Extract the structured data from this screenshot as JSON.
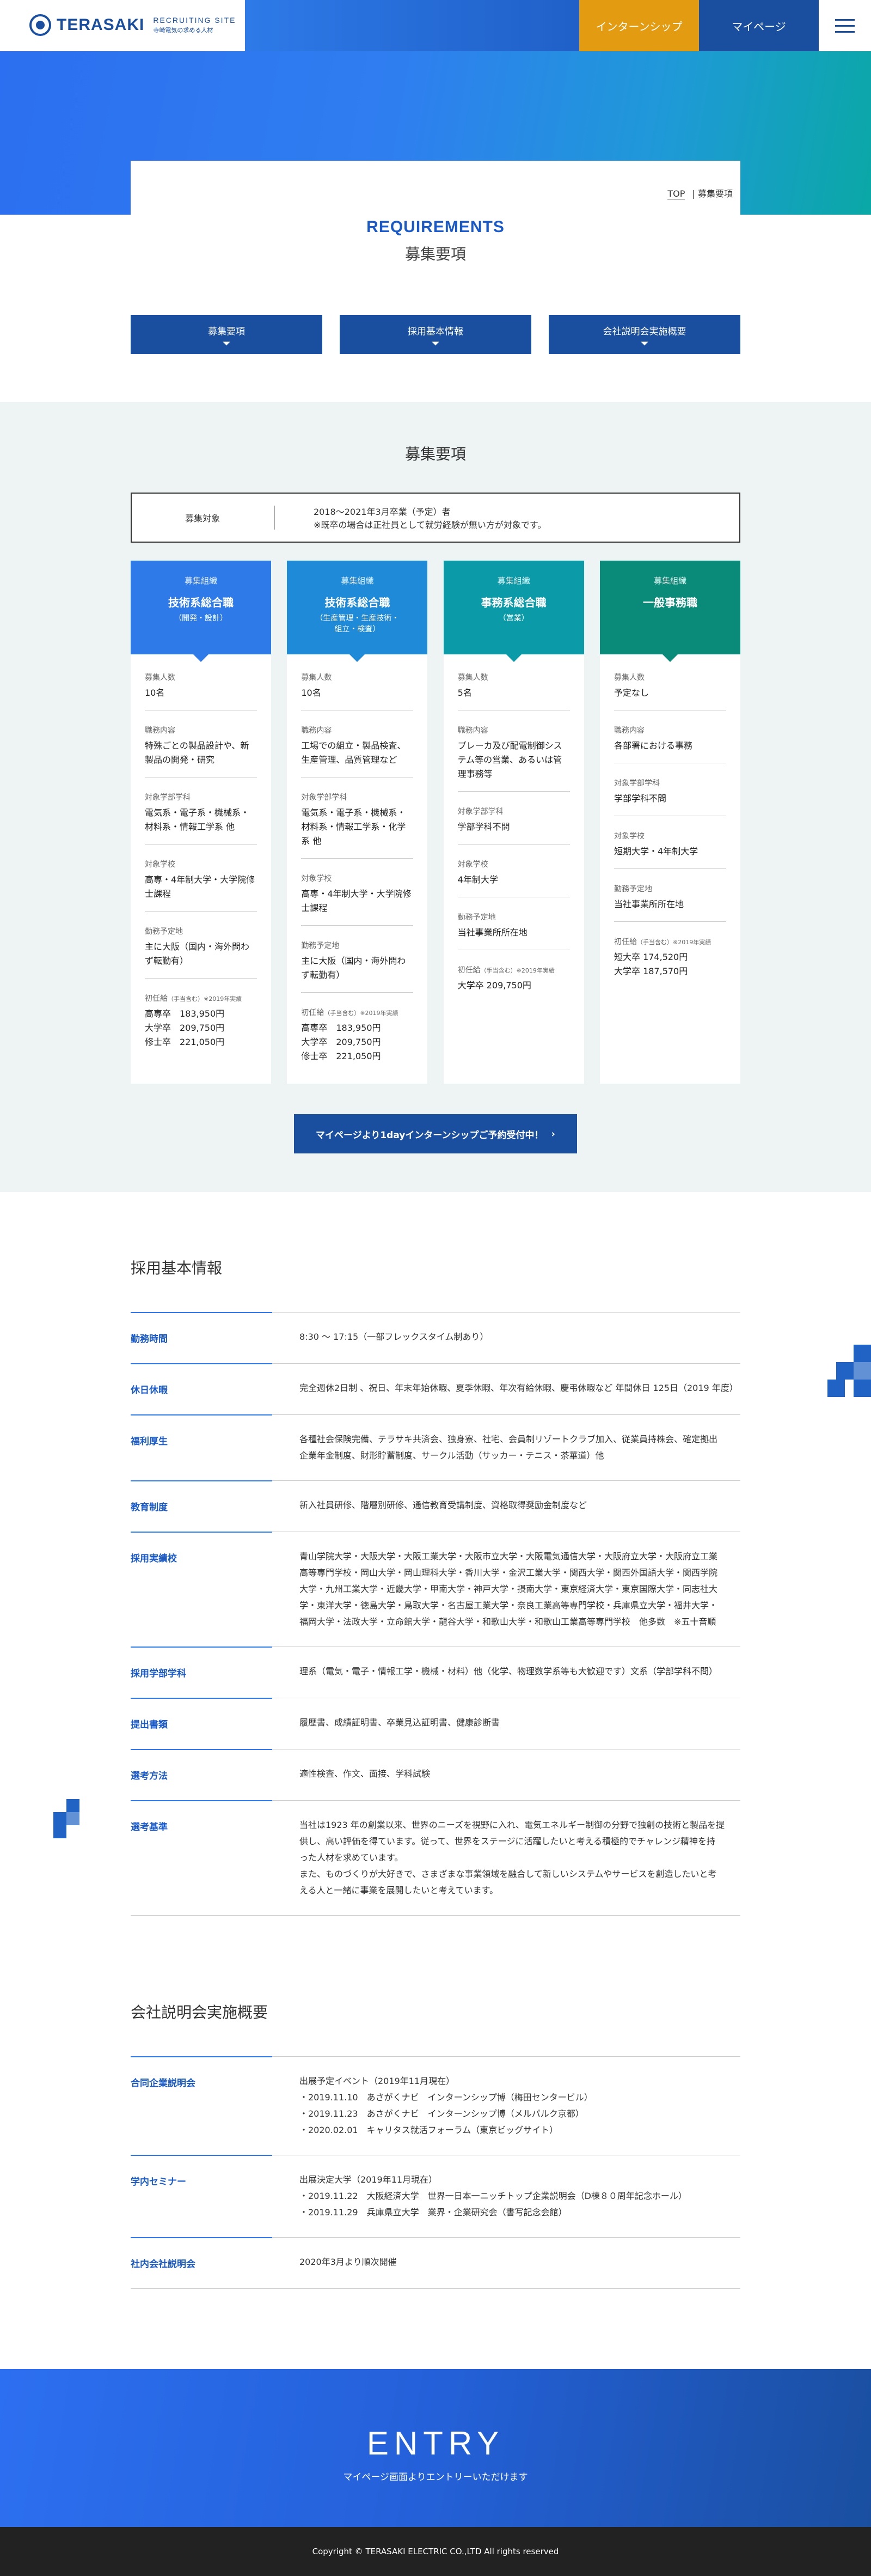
{
  "header": {
    "logo_text": "TERASAKI",
    "logo_sub1": "RECRUITING SITE",
    "logo_sub2": "寺崎電気の求める人材",
    "intern_label": "インターンシップ",
    "mypage_label": "マイページ"
  },
  "breadcrumb": {
    "top": "TOP",
    "sep": "|",
    "current": "募集要項"
  },
  "page": {
    "title_en": "REQUIREMENTS",
    "title_jp": "募集要項"
  },
  "tabs": [
    {
      "label": "募集要項"
    },
    {
      "label": "採用基本情報"
    },
    {
      "label": "会社説明会実施概要"
    }
  ],
  "recruit": {
    "title": "募集要項",
    "target_label": "募集対象",
    "target_line1": "2018～2021年3月卒業（予定）者",
    "target_line2": "※既卒の場合は正社員として就労経験が無い方が対象です。"
  },
  "cards": [
    {
      "small": "募集組織",
      "name": "技術系総合職",
      "sub": "（開発・設計）",
      "color": "#2d7ae8",
      "items": [
        {
          "label": "募集人数",
          "value": "10名"
        },
        {
          "label": "職務内容",
          "value": "特殊ごとの製品設計や、新製品の開発・研究"
        },
        {
          "label": "対象学部学科",
          "value": "電気系・電子系・機械系・材料系・情報工学系 他"
        },
        {
          "label": "対象学校",
          "value": "高専・4年制大学・大学院修士課程"
        },
        {
          "label": "勤務予定地",
          "value": "主に大阪（国内・海外問わず転勤有）"
        },
        {
          "label": "初任給",
          "note": "（手当含む）※2019年実績",
          "value": "高専卒　183,950円\n大学卒　209,750円\n修士卒　221,050円"
        }
      ]
    },
    {
      "small": "募集組織",
      "name": "技術系総合職",
      "sub": "（生産管理・生産技術・\n組立・検査）",
      "color": "#1f8ad8",
      "items": [
        {
          "label": "募集人数",
          "value": "10名"
        },
        {
          "label": "職務内容",
          "value": "工場での組立・製品検査、生産管理、品質管理など"
        },
        {
          "label": "対象学部学科",
          "value": "電気系・電子系・機械系・材料系・情報工学系・化学系 他"
        },
        {
          "label": "対象学校",
          "value": "高専・4年制大学・大学院修士課程"
        },
        {
          "label": "勤務予定地",
          "value": "主に大阪（国内・海外問わず転勤有）"
        },
        {
          "label": "初任給",
          "note": "（手当含む）※2019年実績",
          "value": "高専卒　183,950円\n大学卒　209,750円\n修士卒　221,050円"
        }
      ]
    },
    {
      "small": "募集組織",
      "name": "事務系総合職",
      "sub": "（営業）",
      "color": "#0b9aa8",
      "items": [
        {
          "label": "募集人数",
          "value": "5名"
        },
        {
          "label": "職務内容",
          "value": "ブレーカ及び配電制御システム等の営業、あるいは管理事務等"
        },
        {
          "label": "対象学部学科",
          "value": "学部学科不問"
        },
        {
          "label": "対象学校",
          "value": "4年制大学"
        },
        {
          "label": "勤務予定地",
          "value": "当社事業所所在地"
        },
        {
          "label": "初任給",
          "note": "（手当含む）※2019年実績",
          "value": "大学卒 209,750円"
        }
      ]
    },
    {
      "small": "募集組織",
      "name": "一般事務職",
      "sub": "",
      "color": "#0a8a78",
      "items": [
        {
          "label": "募集人数",
          "value": "予定なし"
        },
        {
          "label": "職務内容",
          "value": "各部署における事務"
        },
        {
          "label": "対象学部学科",
          "value": "学部学科不問"
        },
        {
          "label": "対象学校",
          "value": "短期大学・4年制大学"
        },
        {
          "label": "勤務予定地",
          "value": "当社事業所所在地"
        },
        {
          "label": "初任給",
          "note": "（手当含む）※2019年実績",
          "value": "短大卒 174,520円\n大学卒 187,570円"
        }
      ]
    }
  ],
  "cta": {
    "label": "マイページより1dayインターンシップご予約受付中！",
    "chevron": "›"
  },
  "basic": {
    "title": "採用基本情報",
    "rows": [
      {
        "head": "勤務時間",
        "body": "8:30 ～ 17:15（一部フレックスタイム制あり）"
      },
      {
        "head": "休日休暇",
        "body": "完全週休2日制 、祝日、年末年始休暇、夏季休暇、年次有給休暇、慶弔休暇など 年間休日 125日（2019 年度）"
      },
      {
        "head": "福利厚生",
        "body": "各種社会保険完備、テラサキ共済会、独身寮、社宅、会員制リゾートクラブ加入、従業員持株会、確定拠出\n企業年金制度、財形貯蓄制度、サークル活動（サッカー・テニス・茶華道）他"
      },
      {
        "head": "教育制度",
        "body": "新入社員研修、階層別研修、通信教育受講制度、資格取得奨励金制度など"
      },
      {
        "head": "採用実績校",
        "body": "青山学院大学・大阪大学・大阪工業大学・大阪市立大学・大阪電気通信大学・大阪府立大学・大阪府立工業\n高等専門学校・岡山大学・岡山理科大学・香川大学・金沢工業大学・関西大学・関西外国語大学・関西学院\n大学・九州工業大学・近畿大学・甲南大学・神戸大学・摂南大学・東京経済大学・東京国際大学・同志社大\n学・東洋大学・徳島大学・鳥取大学・名古屋工業大学・奈良工業高等専門学校・兵庫県立大学・福井大学・\n福岡大学・法政大学・立命館大学・龍谷大学・和歌山大学・和歌山工業高等専門学校　他多数　※五十音順"
      },
      {
        "head": "採用学部学科",
        "body": "理系（電気・電子・情報工学・機械・材料）他（化学、物理数学系等も大歓迎です）文系（学部学科不問）"
      },
      {
        "head": "提出書類",
        "body": "履歴書、成績証明書、卒業見込証明書、健康診断書"
      },
      {
        "head": "選考方法",
        "body": "適性検査、作文、面接、学科試験"
      },
      {
        "head": "選考基準",
        "body": "当社は1923 年の創業以来、世界のニーズを視野に入れ、電気エネルギー制御の分野で独創の技術と製品を提\n供し、高い評価を得ています。従って、世界をステージに活躍したいと考える積極的でチャレンジ精神を持\nった人材を求めています。\nまた、ものづくりが大好きで、さまざまな事業領域を融合して新しいシステムやサービスを創造したいと考\nえる人と一緒に事業を展開したいと考えています。"
      }
    ]
  },
  "seminar": {
    "title": "会社説明会実施概要",
    "rows": [
      {
        "head": "合同企業説明会",
        "body": "出展予定イベント（2019年11月現在）\n・2019.11.10　あさがくナビ　インターンシップ博（梅田センタービル）\n・2019.11.23　あさがくナビ　インターンシップ博（メルパルク京都）\n・2020.02.01　キャリタス就活フォーラム（東京ビッグサイト）"
      },
      {
        "head": "学内セミナー",
        "body": "出展決定大学（2019年11月現在）\n・2019.11.22　大阪経済大学　世界一日本一ニッチトップ企業説明会（D棟８０周年記念ホール）\n・2019.11.29　兵庫県立大学　業界・企業研究会（書写記念会館）"
      },
      {
        "head": "社内会社説明会",
        "body": "2020年3月より順次開催"
      }
    ]
  },
  "entry": {
    "title": "ENTRY",
    "sub": "マイページ画面よりエントリーいただけます"
  },
  "footer": {
    "copyright": "Copyright © TERASAKI ELECTRIC CO.,LTD All rights reserved"
  }
}
